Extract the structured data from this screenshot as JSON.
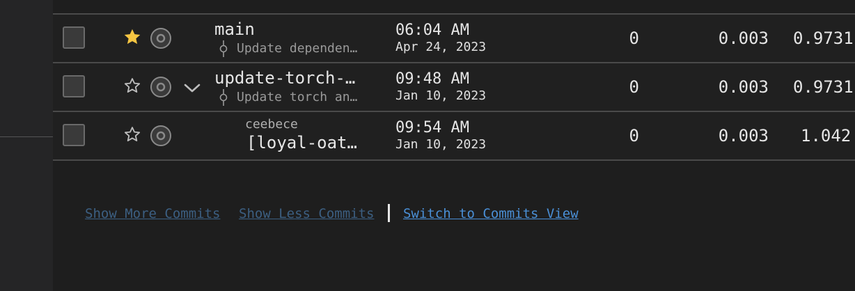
{
  "rows": [
    {
      "name": "main",
      "commit_message": "Update dependen…",
      "time": "06:04 AM",
      "date": "Apr 24, 2023",
      "col1": "0",
      "col2": "0.003",
      "col3": "0.9731",
      "starred": true,
      "expandable": false
    },
    {
      "name": "update-torch-…",
      "commit_message": "Update torch an…",
      "time": "09:48 AM",
      "date": "Jan 10, 2023",
      "col1": "0",
      "col2": "0.003",
      "col3": "0.9731",
      "starred": false,
      "expandable": true
    },
    {
      "hash": "ceebece",
      "name": "[loyal-oat…",
      "time": "09:54 AM",
      "date": "Jan 10, 2023",
      "col1": "0",
      "col2": "0.003",
      "col3": "1.042",
      "starred": false,
      "expandable": false
    }
  ],
  "links": {
    "show_more": "Show More Commits",
    "show_less": "Show Less Commits",
    "switch_view": "Switch to Commits View"
  },
  "colors": {
    "star_active": "#f5c542",
    "link": "#4a8fd6",
    "link_dim": "#3c5f82"
  },
  "icons": {
    "star_filled": "star-filled-icon",
    "star_outline": "star-outline-icon",
    "target": "target-icon",
    "chevron": "chevron-down-icon",
    "commit": "commit-icon"
  }
}
